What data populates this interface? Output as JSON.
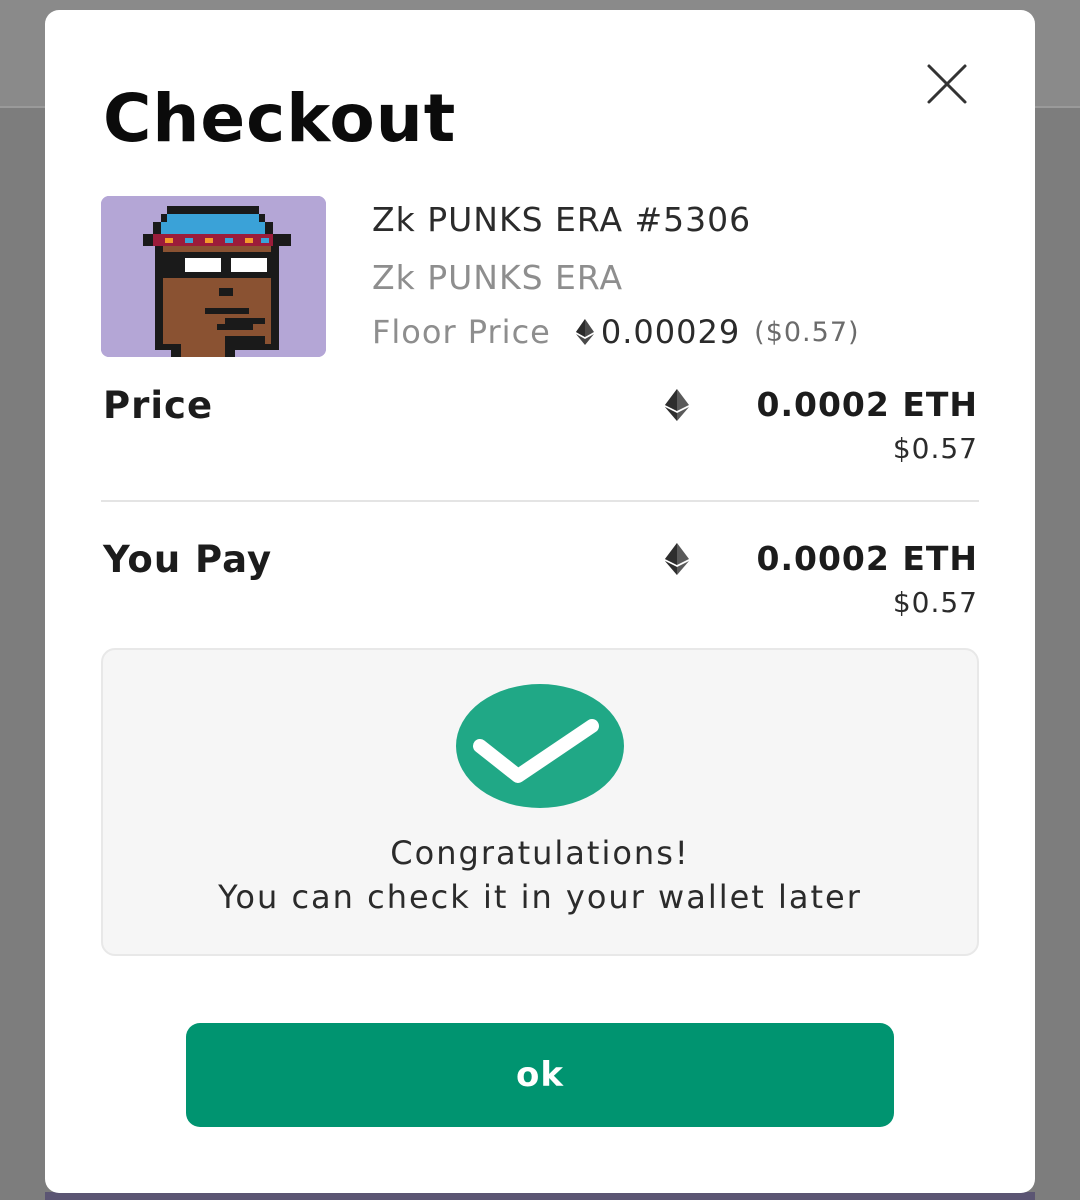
{
  "modal": {
    "title": "Checkout"
  },
  "nft": {
    "name": "Zk PUNKS ERA #5306",
    "collection": "Zk PUNKS ERA",
    "floor_label": "Floor Price",
    "floor_value": "0.00029",
    "floor_usd": "($0.57)"
  },
  "price": {
    "label": "Price",
    "eth": "0.0002 ETH",
    "usd": "$0.57"
  },
  "you_pay": {
    "label": "You Pay",
    "eth": "0.0002 ETH",
    "usd": "$0.57"
  },
  "status": {
    "line1": "Congratulations!",
    "line2": "You can check it in your wallet later"
  },
  "button": {
    "ok_label": "ok"
  },
  "colors": {
    "accent": "#009470",
    "check": "#20a886",
    "nft_bg": "#b4a6d6"
  },
  "icons": {
    "close": "close-icon",
    "eth": "ethereum-icon",
    "success": "check-circle-icon"
  }
}
